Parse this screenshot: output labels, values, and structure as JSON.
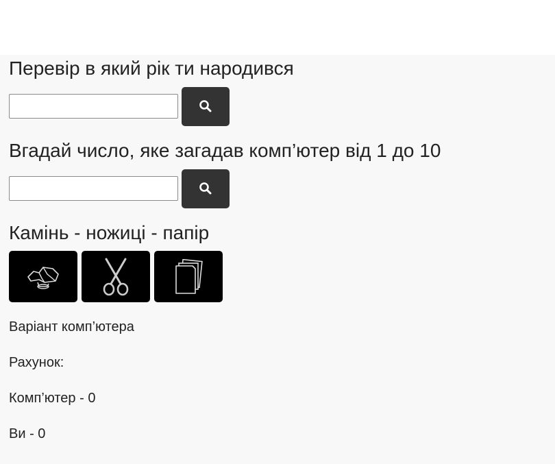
{
  "sections": {
    "year_check": {
      "title": "Перевір в який рік ти народився",
      "input_value": "",
      "button_icon": "search-icon"
    },
    "guess_number": {
      "title": "Вгадай число, яке загадав комп’ютер від 1 до 10",
      "input_value": "",
      "button_icon": "search-icon"
    },
    "rock_paper_scissors": {
      "title": "Камінь - ножиці - папір",
      "buttons": [
        {
          "icon": "rock-icon"
        },
        {
          "icon": "scissors-icon"
        },
        {
          "icon": "paper-icon"
        }
      ]
    }
  },
  "results": {
    "computer_choice_label": "Варіант комп’ютера",
    "score_label": "Рахунок:",
    "computer_score": "Комп’ютер - 0",
    "user_score": "Ви - 0"
  },
  "colors": {
    "button_dark": "#333333",
    "rps_button": "#000000",
    "background": "#f8f8f8"
  }
}
